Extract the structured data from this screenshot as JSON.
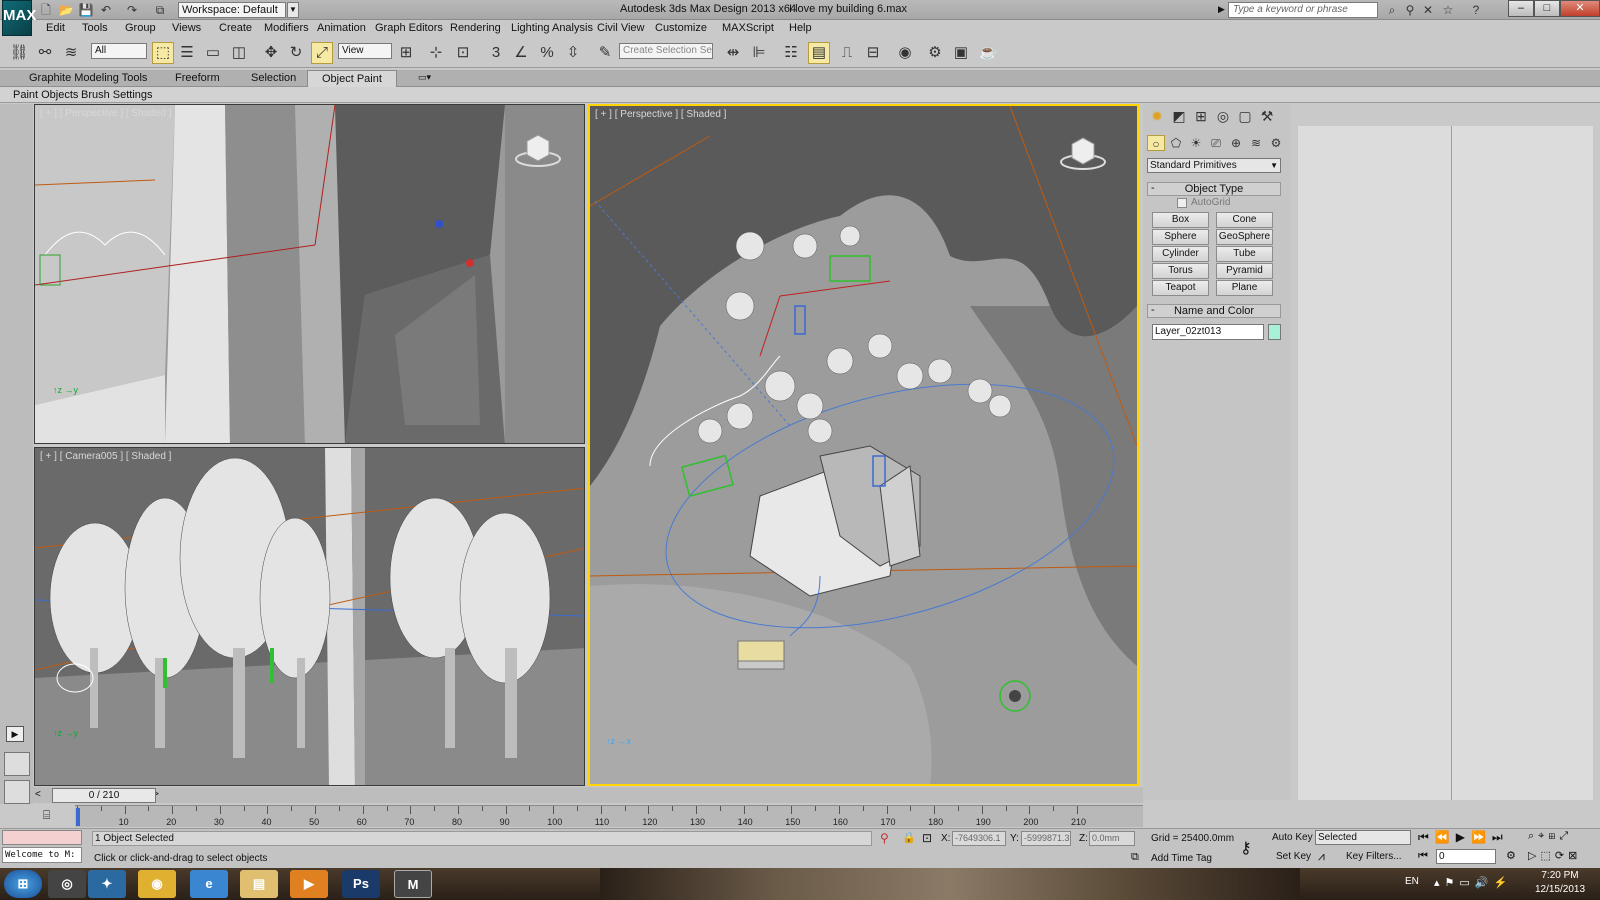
{
  "titlebar": {
    "logo": "MAX",
    "workspace": "Workspace: Default",
    "app_title": "Autodesk 3ds Max Design 2013 x64",
    "file_title": "I love my building 6.max",
    "search_placeholder": "Type a keyword or phrase",
    "minimize": "–",
    "maximize": "□",
    "close": "✕"
  },
  "menubar": [
    "Edit",
    "Tools",
    "Group",
    "Views",
    "Create",
    "Modifiers",
    "Animation",
    "Graph Editors",
    "Rendering",
    "Lighting Analysis",
    "Civil View",
    "Customize",
    "MAXScript",
    "Help"
  ],
  "toolbar": {
    "filter": "All",
    "refcoord": "View",
    "selection_set_placeholder": "Create Selection Se",
    "snap_label": "3",
    "percent_label": "%"
  },
  "ribbon": {
    "tabs": [
      "Graphite Modeling Tools",
      "Freeform",
      "Selection",
      "Object Paint"
    ],
    "active_tab": "Object Paint",
    "subtabs": [
      "Paint Objects",
      "Brush Settings"
    ]
  },
  "viewports": {
    "top_left": "[ + ] [ Perspective ] [ Shaded ]",
    "bottom_left": "[ + ] [ Camera005 ] [ Shaded ]",
    "main": "[ + ] [ Perspective ] [ Shaded ]",
    "viewcube_label": "RIGHT"
  },
  "command_panel": {
    "category": "Standard Primitives",
    "object_type_title": "Object Type",
    "autogrid": "AutoGrid",
    "buttons": [
      "Box",
      "Cone",
      "Sphere",
      "GeoSphere",
      "Cylinder",
      "Tube",
      "Torus",
      "Pyramid",
      "Teapot",
      "Plane"
    ],
    "name_color_title": "Name and Color",
    "object_name": "Layer_02zt013",
    "swatch_color": "#a8f0d8"
  },
  "timeline": {
    "frame": "0 / 210",
    "ticks": [
      "10",
      "20",
      "30",
      "40",
      "50",
      "60",
      "70",
      "80",
      "90",
      "100",
      "110",
      "120",
      "130",
      "140",
      "150",
      "160",
      "170",
      "180",
      "190",
      "200",
      "210"
    ]
  },
  "status": {
    "selected": "1 Object Selected",
    "hint": "Click or click-and-drag to select objects",
    "listener": "Welcome to M:",
    "x_label": "X:",
    "x_value": "-7649306.1",
    "y_label": "Y:",
    "y_value": "-5999871.3",
    "z_label": "Z:",
    "z_value": "0.0mm",
    "grid": "Grid = 25400.0mm",
    "add_time_tag": "Add Time Tag",
    "auto_key": "Auto Key",
    "set_key": "Set Key",
    "key_mode": "Selected",
    "key_filters": "Key Filters...",
    "current_frame": "0"
  },
  "taskbar": {
    "lang": "EN",
    "time": "7:20 PM",
    "date": "12/15/2013",
    "apps": [
      "start",
      "media-center",
      "twitter",
      "chrome",
      "ie",
      "explorer",
      "media-player",
      "photoshop",
      "3dsmax"
    ]
  }
}
